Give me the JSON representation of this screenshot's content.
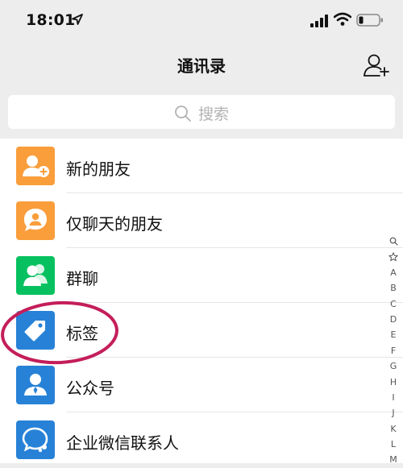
{
  "status_bar": {
    "time": "18:01",
    "icons": [
      "location-arrow-icon",
      "signal-icon",
      "wifi-icon",
      "battery-icon"
    ]
  },
  "header": {
    "title": "通讯录",
    "action_icon": "add-contact-icon"
  },
  "search": {
    "placeholder": "搜索"
  },
  "contacts_menu": [
    {
      "label": "新的朋友",
      "icon": "add-friend-icon",
      "color": "#fa9d3b"
    },
    {
      "label": "仅聊天的朋友",
      "icon": "chat-only-friend-icon",
      "color": "#fa9d3b"
    },
    {
      "label": "群聊",
      "icon": "group-chat-icon",
      "color": "#07c160"
    },
    {
      "label": "标签",
      "icon": "tag-icon",
      "color": "#2782d7"
    },
    {
      "label": "公众号",
      "icon": "official-account-icon",
      "color": "#2782d7"
    },
    {
      "label": "企业微信联系人",
      "icon": "wecom-contact-icon",
      "color": "#2782d7"
    }
  ],
  "index_bar": {
    "icons": [
      "search-icon",
      "star-icon"
    ],
    "letters": [
      "A",
      "B",
      "C",
      "D",
      "E",
      "F",
      "G",
      "H",
      "I",
      "J",
      "K",
      "L",
      "M"
    ]
  },
  "annotation": {
    "type": "circle",
    "color": "#c41e5a",
    "target": "标签"
  }
}
